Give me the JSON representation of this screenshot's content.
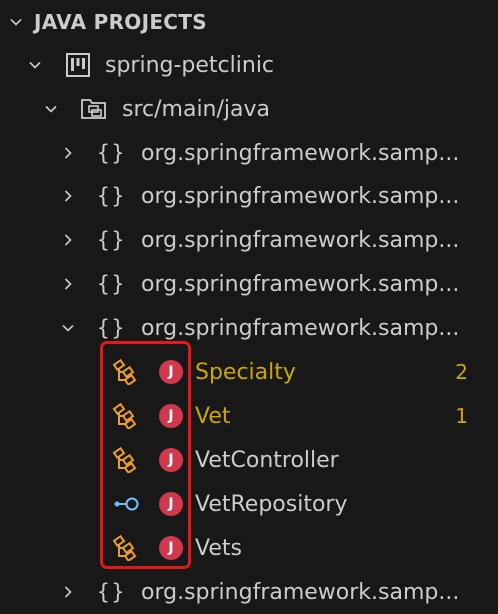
{
  "section": {
    "title": "JAVA PROJECTS"
  },
  "project": {
    "name": "spring-petclinic",
    "icon": "project-board-icon"
  },
  "source_folder": {
    "name": "src/main/java",
    "icon": "folder-package-icon"
  },
  "packages": [
    {
      "label": "org.springframework.samp...",
      "expanded": false
    },
    {
      "label": "org.springframework.samp...",
      "expanded": false
    },
    {
      "label": "org.springframework.samp...",
      "expanded": false
    },
    {
      "label": "org.springframework.samp...",
      "expanded": false
    },
    {
      "label": "org.springframework.samp...",
      "expanded": true
    },
    {
      "label": "org.springframework.samp...",
      "expanded": false
    }
  ],
  "classes": [
    {
      "name": "Specialty",
      "icon": "class-hierarchy-icon",
      "badge": "2",
      "warning": true
    },
    {
      "name": "Vet",
      "icon": "class-hierarchy-icon",
      "badge": "1",
      "warning": true
    },
    {
      "name": "VetController",
      "icon": "class-hierarchy-icon",
      "badge": "",
      "warning": false
    },
    {
      "name": "VetRepository",
      "icon": "interface-icon",
      "badge": "",
      "warning": false
    },
    {
      "name": "Vets",
      "icon": "class-hierarchy-icon",
      "badge": "",
      "warning": false
    }
  ],
  "file_badge_letter": "J",
  "colors": {
    "background": "#181818",
    "text": "#cccccc",
    "warning": "#cca700",
    "java_badge": "#d1384d",
    "class_icon": "#ee9d28",
    "interface_icon": "#75beff",
    "highlight_box": "#e01919"
  }
}
